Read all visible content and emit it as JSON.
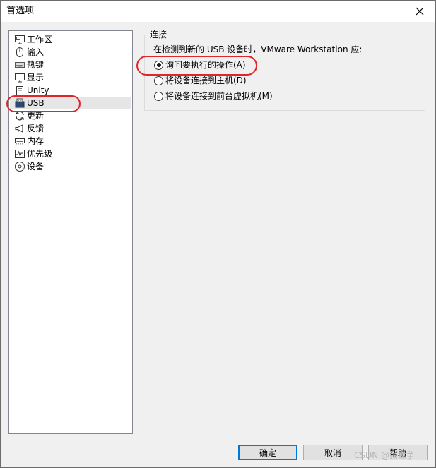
{
  "window": {
    "title": "首选项"
  },
  "nav": {
    "items": [
      {
        "label": "工作区",
        "icon": "workspace-icon"
      },
      {
        "label": "输入",
        "icon": "mouse-icon"
      },
      {
        "label": "热键",
        "icon": "keyboard-icon"
      },
      {
        "label": "显示",
        "icon": "monitor-icon"
      },
      {
        "label": "Unity",
        "icon": "unity-icon"
      },
      {
        "label": "USB",
        "icon": "usb-icon",
        "selected": true
      },
      {
        "label": "更新",
        "icon": "refresh-icon"
      },
      {
        "label": "反馈",
        "icon": "megaphone-icon"
      },
      {
        "label": "内存",
        "icon": "memory-icon"
      },
      {
        "label": "优先级",
        "icon": "priority-icon"
      },
      {
        "label": "设备",
        "icon": "device-icon"
      }
    ]
  },
  "connection": {
    "group_title": "连接",
    "description": "在检测到新的 USB 设备时，VMware Workstation 应:",
    "options": [
      {
        "label": "询问要执行的操作(A)",
        "checked": true
      },
      {
        "label": "将设备连接到主机(D)",
        "checked": false
      },
      {
        "label": "将设备连接到前台虚拟机(M)",
        "checked": false
      }
    ]
  },
  "buttons": {
    "ok": "确定",
    "cancel": "取消",
    "help": "帮助"
  },
  "watermark": "CSDN @张世争",
  "colors": {
    "annotation": "#e0262b",
    "default_button_border": "#0078d7",
    "selected_item_bg": "#e6e6e6"
  }
}
